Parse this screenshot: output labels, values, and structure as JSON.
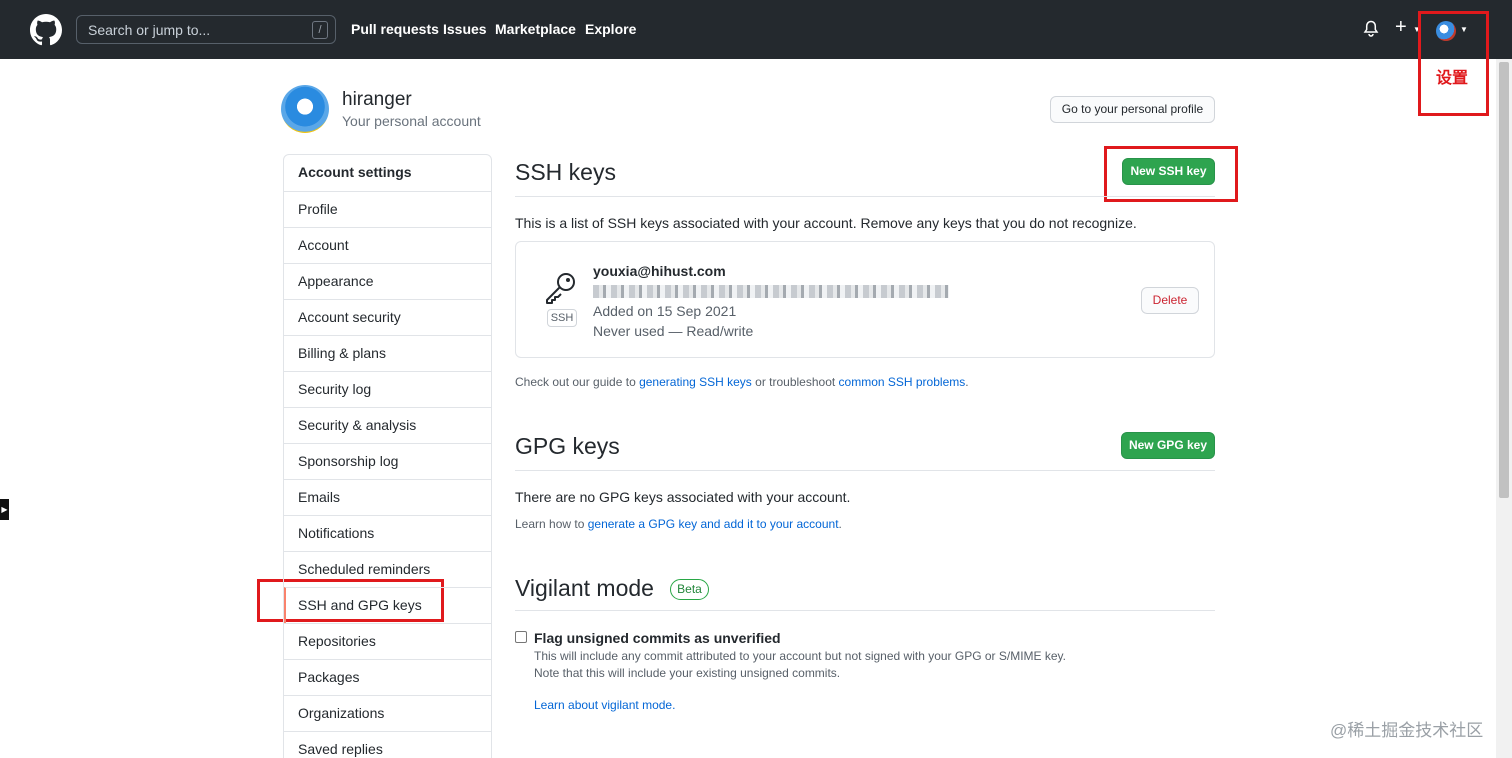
{
  "header": {
    "search_placeholder": "Search or jump to...",
    "search_shortcut": "/",
    "nav": [
      "Pull requests",
      "Issues",
      "Marketplace",
      "Explore"
    ],
    "plus_label": "+"
  },
  "annotation": {
    "settings_label": "设置"
  },
  "profile": {
    "username": "hiranger",
    "subtitle": "Your personal account",
    "go_profile_button": "Go to your personal profile"
  },
  "sidebar": {
    "items": [
      "Account settings",
      "Profile",
      "Account",
      "Appearance",
      "Account security",
      "Billing & plans",
      "Security log",
      "Security & analysis",
      "Sponsorship log",
      "Emails",
      "Notifications",
      "Scheduled reminders",
      "SSH and GPG keys",
      "Repositories",
      "Packages",
      "Organizations",
      "Saved replies"
    ],
    "active_index": 12
  },
  "ssh": {
    "title": "SSH keys",
    "new_button": "New SSH key",
    "description": "This is a list of SSH keys associated with your account. Remove any keys that you do not recognize.",
    "key": {
      "title": "youxia@hihust.com",
      "badge": "SSH",
      "added": "Added on 15 Sep 2021",
      "usage": "Never used — Read/write",
      "delete_button": "Delete"
    },
    "guide": {
      "prefix": "Check out our guide to ",
      "link1": "generating SSH keys",
      "middle": " or troubleshoot ",
      "link2": "common SSH problems",
      "suffix": "."
    }
  },
  "gpg": {
    "title": "GPG keys",
    "new_button": "New GPG key",
    "empty": "There are no GPG keys associated with your account.",
    "learn_prefix": "Learn how to ",
    "learn_link": "generate a GPG key and add it to your account",
    "learn_suffix": "."
  },
  "vigilant": {
    "title": "Vigilant mode",
    "badge": "Beta",
    "checkbox_label": "Flag unsigned commits as unverified",
    "desc1": "This will include any commit attributed to your account but not signed with your GPG or S/MIME key.",
    "desc2": "Note that this will include your existing unsigned commits.",
    "learn_link": "Learn about vigilant mode."
  },
  "watermark": "@稀土掘金技术社区",
  "colors": {
    "header_bg": "#24292e",
    "accent_green": "#2ea44f",
    "annotation_red": "#e0191c",
    "link": "#0366d6"
  }
}
